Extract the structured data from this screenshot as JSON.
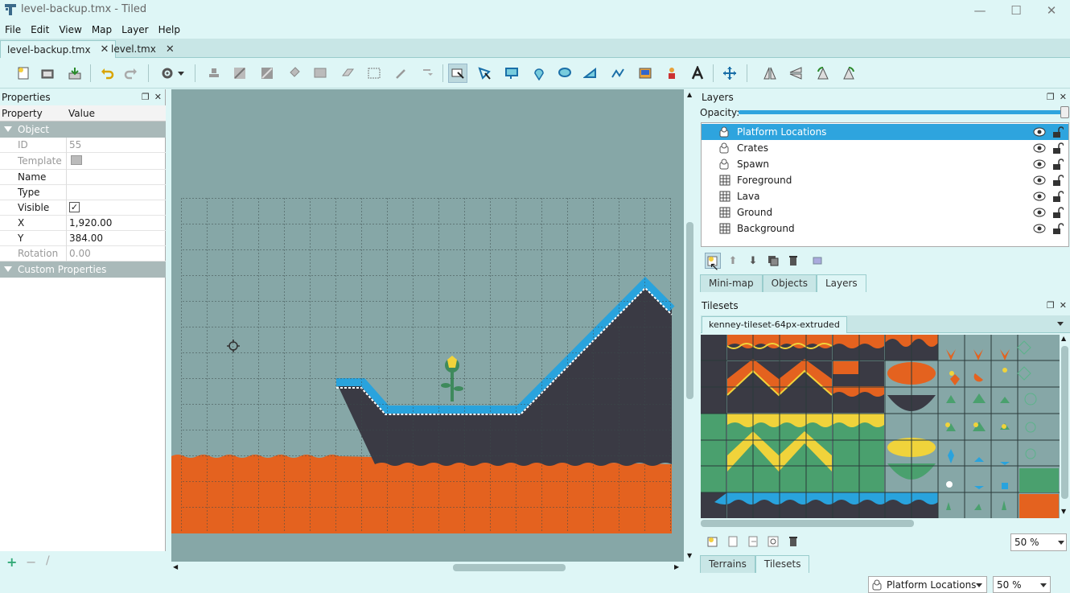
{
  "window": {
    "title": "level-backup.tmx - Tiled",
    "minimize": "—",
    "maximize": "☐",
    "close": "✕"
  },
  "menu": [
    "File",
    "Edit",
    "View",
    "Map",
    "Layer",
    "Help"
  ],
  "tabs": [
    {
      "label": "level-backup.tmx",
      "close": "✕",
      "active": true
    },
    {
      "label": "level.tmx",
      "close": "✕",
      "active": false
    }
  ],
  "toolbar_icons": [
    "new-map-icon",
    "open-icon",
    "save-icon",
    "undo-icon",
    "redo-icon",
    "commands-icon",
    "stamp-brush-icon",
    "terrain-brush-icon",
    "wang-brush-icon",
    "bucket-fill-icon",
    "shape-fill-icon",
    "eraser-icon",
    "rect-select-icon",
    "magic-wand-icon",
    "select-same-tile-icon",
    "select-objects-icon",
    "edit-polygons-icon",
    "insert-rectangle-icon",
    "insert-point-icon",
    "insert-ellipse-icon",
    "insert-polygon-icon",
    "insert-polyline-icon",
    "insert-tile-icon",
    "insert-template-icon",
    "insert-text-icon",
    "move-icon",
    "flip-horizontal-icon",
    "flip-vertical-icon",
    "rotate-left-icon",
    "rotate-right-icon"
  ],
  "properties": {
    "title": "Properties",
    "col_property": "Property",
    "col_value": "Value",
    "group_object": "Object",
    "rows": [
      {
        "key": "ID",
        "value": "55",
        "disabled": true
      },
      {
        "key": "Template",
        "value": "",
        "disabled": true
      },
      {
        "key": "Name",
        "value": "",
        "disabled": false
      },
      {
        "key": "Type",
        "value": "",
        "disabled": false
      },
      {
        "key": "Visible",
        "value": "✓",
        "disabled": false
      },
      {
        "key": "X",
        "value": "1,920.00",
        "disabled": false
      },
      {
        "key": "Y",
        "value": "384.00",
        "disabled": false
      },
      {
        "key": "Rotation",
        "value": "0.00",
        "disabled": true
      }
    ],
    "group_custom": "Custom Properties"
  },
  "layers": {
    "title": "Layers",
    "opacity_label": "Opacity:",
    "opacity": 1.0,
    "items": [
      {
        "name": "Platform Locations",
        "type": "object",
        "selected": true
      },
      {
        "name": "Crates",
        "type": "object",
        "selected": false
      },
      {
        "name": "Spawn",
        "type": "object",
        "selected": false
      },
      {
        "name": "Foreground",
        "type": "tile",
        "selected": false
      },
      {
        "name": "Lava",
        "type": "tile",
        "selected": false
      },
      {
        "name": "Ground",
        "type": "tile",
        "selected": false
      },
      {
        "name": "Background",
        "type": "tile",
        "selected": false
      }
    ],
    "bottom_tabs": [
      "Mini-map",
      "Objects",
      "Layers"
    ]
  },
  "tilesets": {
    "title": "Tilesets",
    "tab": "kenney-tileset-64px-extruded",
    "zoom": "50 %",
    "bottom_tabs": [
      "Terrains",
      "Tilesets"
    ]
  },
  "status": {
    "layer": "Platform Locations",
    "zoom": "50 %"
  },
  "colors": {
    "accent": "#2ea4de",
    "lava": "#e4621f",
    "ground": "#3a3a44",
    "water": "#29a3dd",
    "bg": "#86a7a7",
    "chrome": "#def6f6"
  }
}
